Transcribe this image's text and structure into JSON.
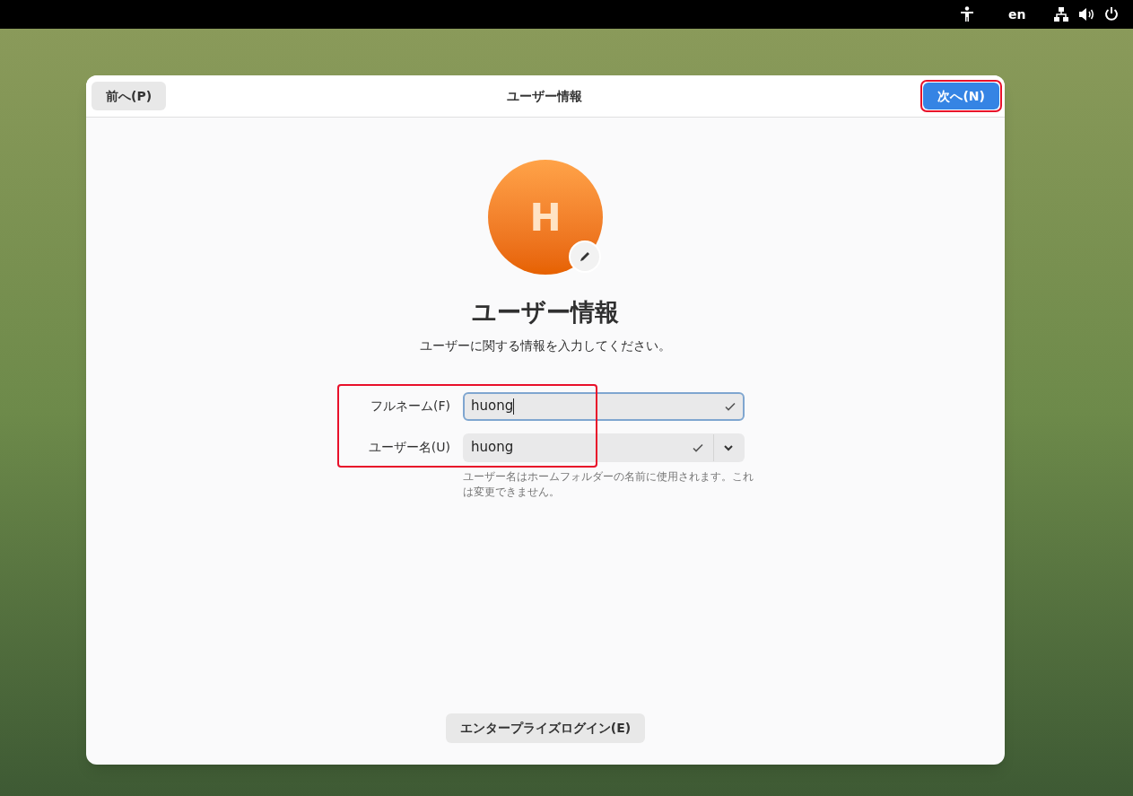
{
  "top_bar": {
    "language": "en"
  },
  "dialog": {
    "back_button": {
      "label": "前へ(P)"
    },
    "title": "ユーザー情報",
    "next_button": {
      "label": "次へ(N)",
      "highlighted": true
    }
  },
  "avatar": {
    "initial": "H"
  },
  "heading": "ユーザー情報",
  "subtitle": "ユーザーに関する情報を入力してください。",
  "form": {
    "highlighted": true,
    "fields": [
      {
        "kind": "text",
        "label": "フルネーム(F)",
        "value": "huong",
        "focused": true,
        "valid": true
      },
      {
        "kind": "combo",
        "label": "ユーザー名(U)",
        "value": "huong",
        "focused": false,
        "valid": true
      }
    ],
    "hint": "ユーザー名はホームフォルダーの名前に使用されます。これは変更できません。"
  },
  "enterprise_button": {
    "label": "エンタープライズログイン(E)"
  }
}
